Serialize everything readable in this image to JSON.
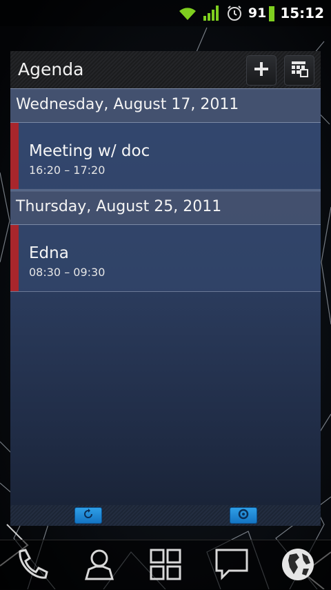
{
  "status_bar": {
    "battery_level": "91",
    "time": "15:12",
    "icons": [
      "wifi-icon",
      "signal-icon",
      "alarm-icon",
      "battery-icon"
    ]
  },
  "widget": {
    "title": "Agenda",
    "header_buttons": [
      "add-icon",
      "calendar-icon"
    ],
    "days": [
      {
        "date": "Wednesday, August 17, 2011",
        "events": [
          {
            "title": "Meeting w/ doc",
            "time": "16:20 – 17:20",
            "color": "#a8262c"
          }
        ]
      },
      {
        "date": "Thursday, August 25, 2011",
        "events": [
          {
            "title": "Edna",
            "time": "08:30 – 09:30",
            "color": "#a8262c"
          }
        ]
      }
    ],
    "footer_buttons": [
      "refresh-icon",
      "settings-icon"
    ]
  },
  "dock": {
    "items": [
      "phone-icon",
      "contacts-icon",
      "apps-icon",
      "messaging-icon",
      "browser-icon"
    ]
  },
  "colors": {
    "accent_blue": "#1e88d8",
    "event_marker": "#a8262c",
    "widget_body": "#2c3d5f"
  }
}
